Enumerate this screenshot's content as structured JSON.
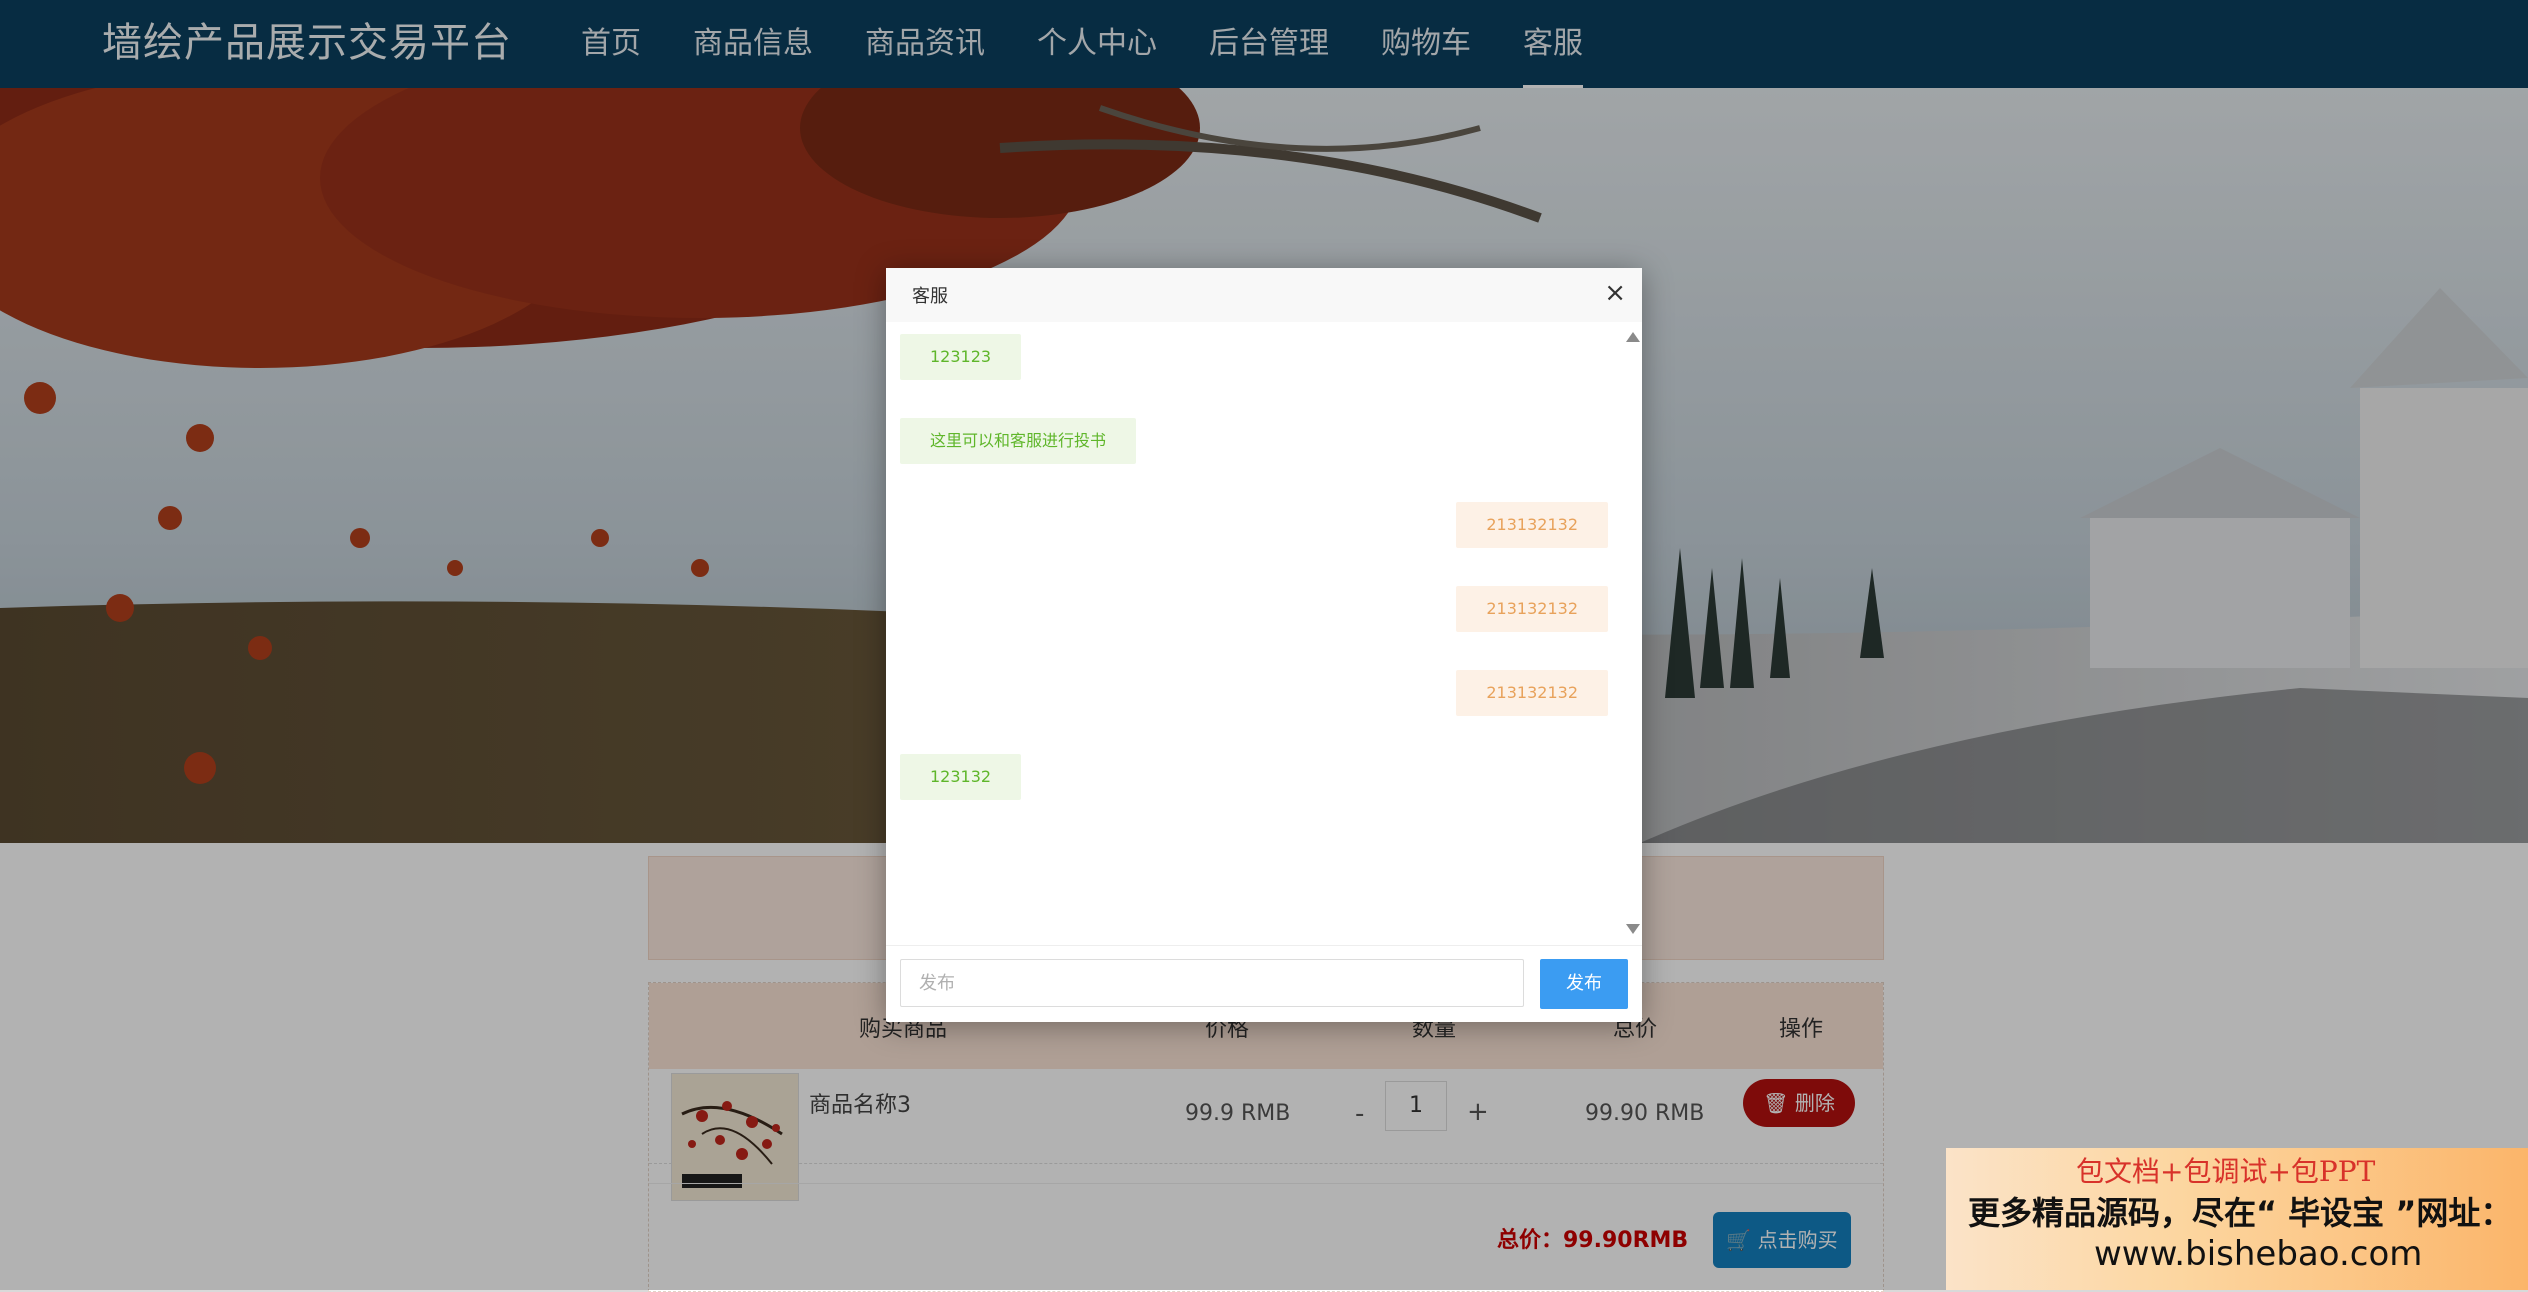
{
  "nav": {
    "brand": "墙绘产品展示交易平台",
    "items": [
      {
        "label": "首页"
      },
      {
        "label": "商品信息"
      },
      {
        "label": "商品资讯"
      },
      {
        "label": "个人中心"
      },
      {
        "label": "后台管理"
      },
      {
        "label": "购物车"
      },
      {
        "label": "客服"
      }
    ],
    "active": "客服"
  },
  "cart": {
    "headers": {
      "product": "购买商品",
      "price": "价格",
      "qty": "数量",
      "total": "总价",
      "action": "操作"
    },
    "rows": [
      {
        "name": "商品名称3",
        "price": "99.9 RMB",
        "minus": "-",
        "qty": "1",
        "plus": "+",
        "total": "99.90 RMB",
        "delete": "删除"
      }
    ],
    "grand_total": "总价：99.90RMB",
    "buy_label": "点击购买"
  },
  "modal": {
    "title": "客服",
    "close": "×",
    "messages": [
      {
        "side": "left",
        "text": "123123"
      },
      {
        "side": "left",
        "text": "这里可以和客服进行投书"
      },
      {
        "side": "right",
        "text": "213132132"
      },
      {
        "side": "right",
        "text": "213132132"
      },
      {
        "side": "right",
        "text": "213132132"
      },
      {
        "side": "left",
        "text": "123132"
      }
    ],
    "input_placeholder": "发布",
    "send_label": "发布"
  },
  "ad": {
    "line1": "包文档+包调试+包PPT",
    "line2": "更多精品源码，尽在“ 毕设宝 ”网址：",
    "line3": "www.bishebao.com"
  },
  "colors": {
    "nav_bg": "#0b3f5f",
    "send_button": "#3b9cf2",
    "delete_button": "#b5100f",
    "buy_button": "#1480bf"
  }
}
